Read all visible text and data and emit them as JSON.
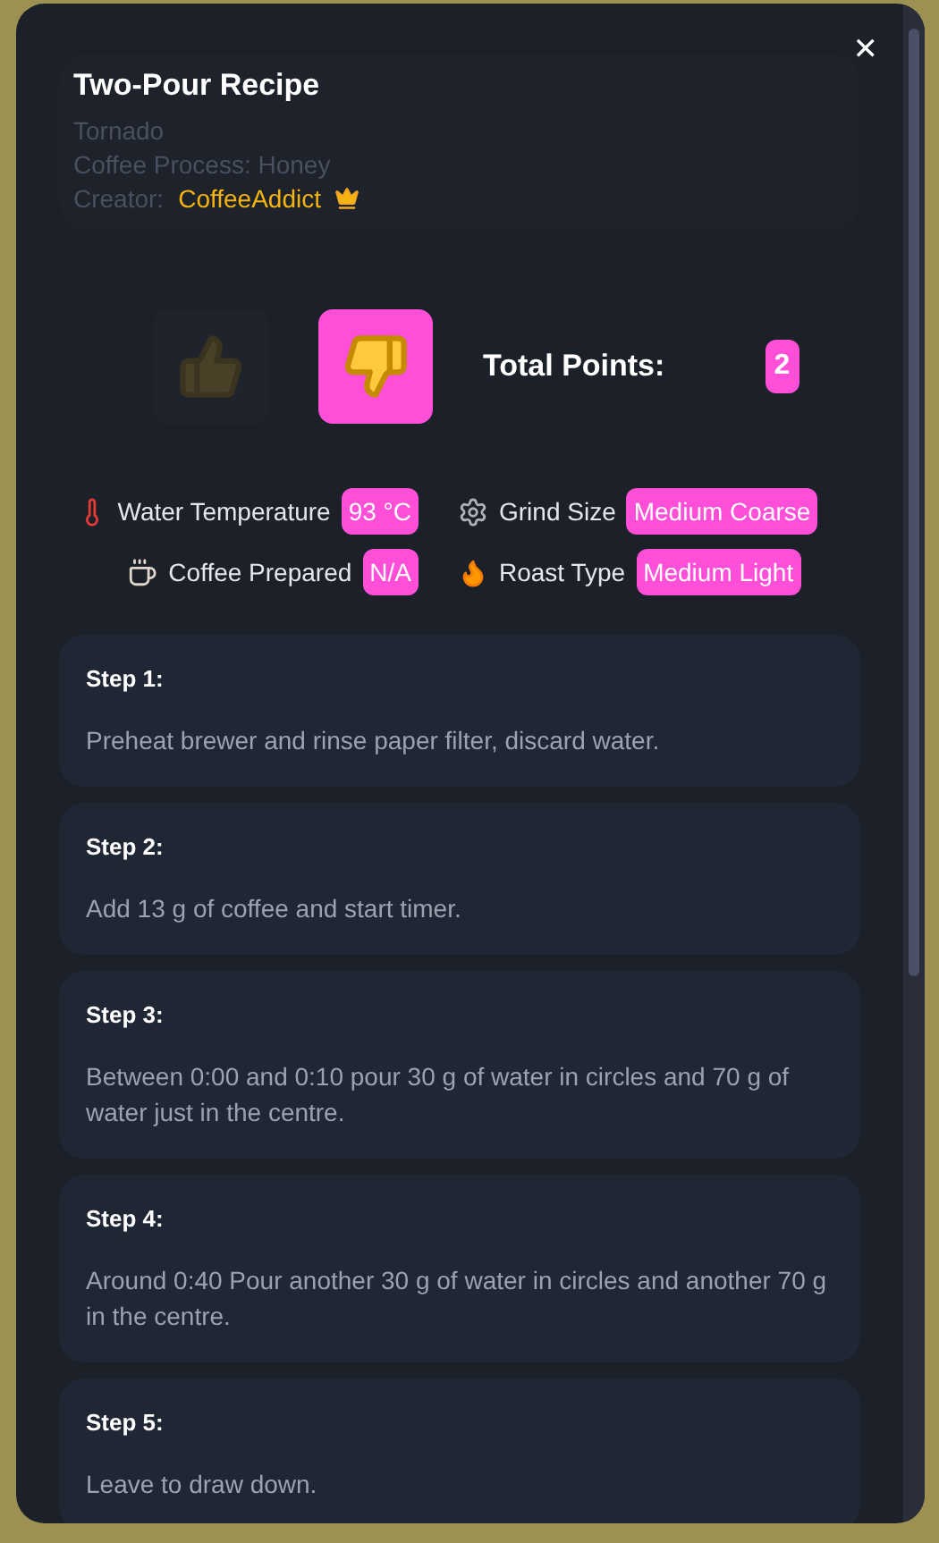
{
  "modal": {
    "title": "Two-Pour Recipe",
    "brewer": "Tornado",
    "process": "Coffee Process: Honey",
    "creator_label": "Creator:",
    "creator": "CoffeeAddict",
    "close": "✕"
  },
  "votes": [
    {
      "kind": "up",
      "selected": false
    },
    {
      "kind": "down",
      "selected": true
    }
  ],
  "points": {
    "label": "Total Points:",
    "value": "2"
  },
  "params": [
    {
      "kind": "temperature",
      "label": "Water Temperature",
      "value": "93 °C"
    },
    {
      "kind": "grind",
      "label": "Grind Size",
      "value": "Medium Coarse"
    },
    {
      "kind": "coffee",
      "label": "Coffee Prepared",
      "value": "N/A"
    },
    {
      "kind": "roast",
      "label": "Roast Type",
      "value": "Medium Light"
    }
  ],
  "steps": [
    {
      "title": "Step 1:",
      "text": "Preheat brewer and rinse paper filter, discard water."
    },
    {
      "title": "Step 2:",
      "text": "Add 13 g of coffee and start timer."
    },
    {
      "title": "Step 3:",
      "text": "Between 0:00 and 0:10 pour 30 g of water in circles and 70 g of water just in the centre."
    },
    {
      "title": "Step 4:",
      "text": "Around 0:40 Pour another 30 g of water in circles and another 70 g in the centre."
    },
    {
      "title": "Step 5:",
      "text": "Leave to draw down."
    }
  ]
}
